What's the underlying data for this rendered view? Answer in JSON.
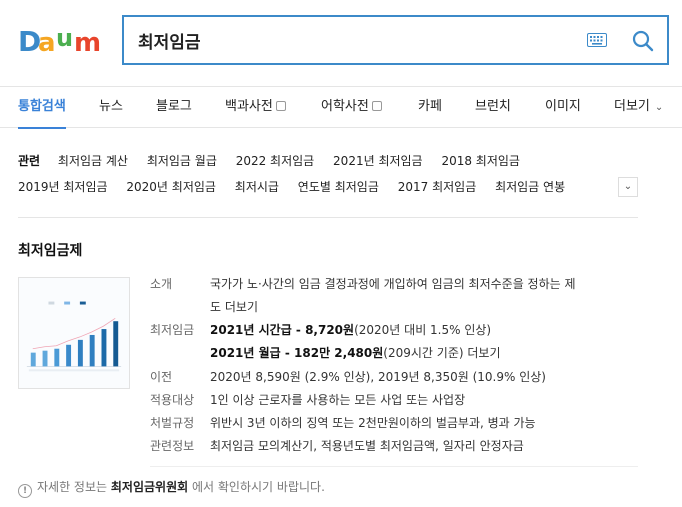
{
  "header": {
    "logo_text": "Daum",
    "search_value": "최저임금",
    "colors": {
      "accent": "#3c8ac9"
    }
  },
  "nav": {
    "items": [
      {
        "label": "통합검색",
        "active": true
      },
      {
        "label": "뉴스"
      },
      {
        "label": "블로그"
      },
      {
        "label": "백과사전"
      },
      {
        "label": "어학사전"
      },
      {
        "label": "카페"
      },
      {
        "label": "브런치"
      },
      {
        "label": "이미지"
      },
      {
        "label": "더보기"
      }
    ]
  },
  "related": {
    "label": "관련",
    "row1": [
      "최저임금 계산",
      "최저임금 월급",
      "2022 최저임금",
      "2021년 최저임금",
      "2018 최저임금"
    ],
    "row2": [
      "2019년 최저임금",
      "2020년 최저임금",
      "최저시급",
      "연도별 최저임금",
      "2017 최저임금",
      "최저임금 연봉"
    ]
  },
  "card": {
    "title": "최저임금제",
    "intro_key": "소개",
    "intro_line1": "국가가 노·사간의 임금 결정과정에 개입하여 임금의 최저수준을 정하는 제",
    "intro_line2": "도",
    "more": "더보기",
    "wage_key": "최저임금",
    "wage_hourly": "2021년 시간급 - 8,720원",
    "wage_hourly_note": "(2020년 대비 1.5% 인상)",
    "wage_monthly": "2021년 월급 - 182만 2,480원",
    "wage_monthly_note": "(209시간 기준)",
    "prev_key": "이전",
    "prev_val": "2020년 8,590원 (2.9% 인상), 2019년 8,350원 (10.9% 인상)",
    "scope_key": "적용대상",
    "scope_val": "1인 이상 근로자를 사용하는 모든 사업 또는 사업장",
    "penalty_key": "처벌규정",
    "penalty_val": "위반시 3년 이하의 징역 또는 2천만원이하의 벌금부과, 병과 가능",
    "related_key": "관련정보",
    "related_links": [
      "최저임금 모의계산기",
      "적용년도별 최저임금액",
      "일자리 안정자금"
    ]
  },
  "footnote": {
    "before": "자세한 정보는",
    "org": "최저임금위원회",
    "after": "에서 확인하시기 바랍니다."
  }
}
